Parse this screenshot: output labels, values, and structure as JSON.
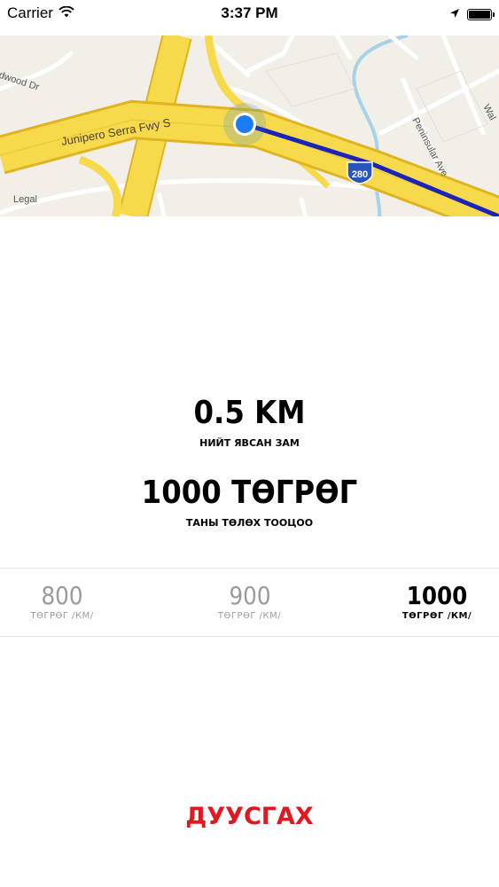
{
  "status_bar": {
    "carrier": "Carrier",
    "time": "3:37 PM",
    "icons": [
      "wifi-icon",
      "location-arrow-icon",
      "battery-icon"
    ]
  },
  "map": {
    "street_labels": {
      "highway": "Junipero Serra Fwy S",
      "road_left": "dwood Dr",
      "road_right": "Peninsular Ave",
      "road_corner": "Wal",
      "shield_number": "280"
    },
    "legal_label": "Legal",
    "colors": {
      "highway": "#f7d94c",
      "highway_edge": "#e0b421",
      "route": "#1a24b8",
      "location_dot": "#1b7cf5",
      "water": "#a6d3e8",
      "land": "#f2efe9"
    }
  },
  "stats": {
    "distance_value": "0.5 KM",
    "distance_label": "НИЙТ ЯВСАН ЗАМ",
    "fare_value": "1000 ТӨГРӨГ",
    "fare_label": "ТАНЫ ТӨЛӨХ ТООЦОО"
  },
  "rates": [
    {
      "value": "800",
      "unit": "ТӨГРӨГ /КМ/",
      "selected": false
    },
    {
      "value": "900",
      "unit": "ТӨГРӨГ /КМ/",
      "selected": false
    },
    {
      "value": "1000",
      "unit": "ТӨГРӨГ /КМ/",
      "selected": true
    }
  ],
  "finish_label": "ДУУСГАХ",
  "accent_color": "#e3171e"
}
